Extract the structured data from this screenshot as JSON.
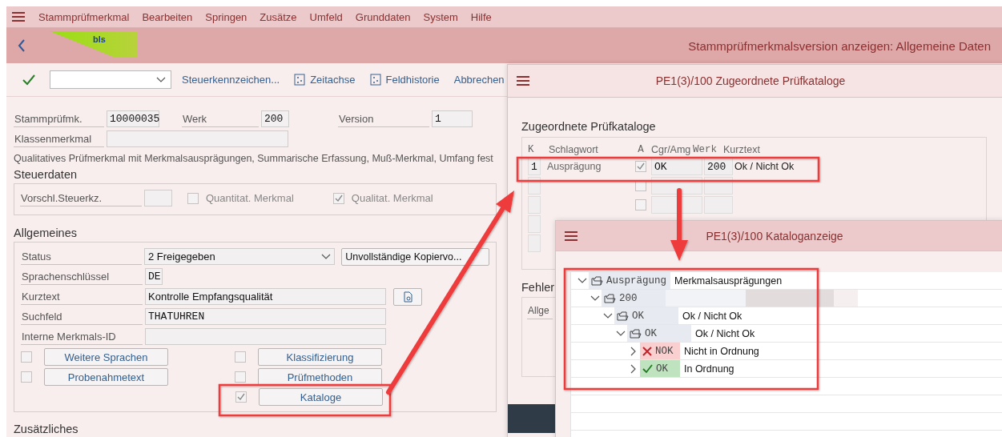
{
  "menu": [
    {
      "label": "Stammprüfmerkmal"
    },
    {
      "label": "Bearbeiten"
    },
    {
      "label": "Springen"
    },
    {
      "label": "Zusätze"
    },
    {
      "label": "Umfeld"
    },
    {
      "label": "Grunddaten"
    },
    {
      "label": "System"
    },
    {
      "label": "Hilfe"
    }
  ],
  "header": {
    "logo": "bls",
    "title": "Stammprüfmerkmalsversion anzeigen: Allgemeine Daten"
  },
  "toolbar": [
    {
      "kind": "text",
      "label": "Steuerkennzeichen..."
    },
    {
      "kind": "icon",
      "label": "Zeitachse"
    },
    {
      "kind": "icon",
      "label": "Feldhistorie"
    },
    {
      "kind": "text",
      "label": "Abbrechen"
    }
  ],
  "head_fields": [
    {
      "label": "Stammprüfmk.",
      "value": "10000035"
    },
    {
      "label": "Werk",
      "value": "200"
    },
    {
      "label": "Version",
      "value": "1"
    }
  ],
  "klassenmerkmal": {
    "label": "Klassenmerkmal"
  },
  "description": "Qualitatives Prüfmerkmal mit Merkmalsausprägungen, Summarische Erfassung, Muß-Merkmal, Umfang fest",
  "steuerdaten": {
    "heading": "Steuerdaten",
    "field_label": "Vorschl.Steuerkz.",
    "checkboxes": [
      {
        "label": "Quantitat. Merkmal",
        "checked": false
      },
      {
        "label": "Qualitat. Merkmal",
        "checked": true
      }
    ]
  },
  "allgemeines": {
    "heading": "Allgemeines",
    "status": {
      "label": "Status",
      "value": "2 Freigegeben",
      "button": "Unvollständige Kopiervo..."
    },
    "fields": [
      {
        "label": "Sprachenschlüssel",
        "value": "DE",
        "kind": "short"
      },
      {
        "label": "Kurztext",
        "value": "Kontrolle Empfangsqualität",
        "kind": "text"
      },
      {
        "label": "Suchfeld",
        "value": "THATUHREN",
        "kind": "mono"
      },
      {
        "label": "Interne Merkmals-ID",
        "kind": "empty"
      }
    ],
    "buttons": [
      [
        {
          "label": "Weitere Sprachen",
          "checked": false
        },
        {
          "label": "Klassifizierung",
          "checked": false
        }
      ],
      [
        {
          "label": "Probenahmetext",
          "checked": false
        },
        {
          "label": "Prüfmethoden",
          "checked": false
        }
      ],
      [
        {
          "label": "Kataloge",
          "checked": true
        }
      ]
    ]
  },
  "next_heading": "Zusätzliches",
  "dialog_catalogs": {
    "title": "PE1(3)/100 Zugeordnete Prüfkataloge",
    "heading": "Zugeordnete Prüfkataloge",
    "columns": [
      "K",
      "Schlagwort",
      "A",
      "Cgr/Amg",
      "Werk",
      "Kurztext"
    ],
    "rows": [
      {
        "kind": "full",
        "k": "1",
        "schlagwort": "Ausprägung",
        "checked": true,
        "cgr": "OK",
        "werk": "200",
        "kurztext": "Ok / Nicht Ok"
      },
      {
        "kind": "full",
        "checked": false
      },
      {
        "kind": "full",
        "checked": false
      },
      {
        "kind": "partial"
      },
      {
        "kind": "partial"
      }
    ],
    "second_heading": "Fehler",
    "second_label": "Allge"
  },
  "dialog_display": {
    "title": "PE1(3)/100 Kataloganzeige",
    "tree": [
      {
        "kind": "folder",
        "expanded": true,
        "key": "Ausprägung",
        "text": "Merkmalsausprägungen",
        "children": [
          {
            "kind": "folder",
            "expanded": true,
            "key": "200",
            "blurred": true,
            "children": [
              {
                "kind": "folder",
                "expanded": true,
                "key": "OK",
                "text": "Ok / Nicht Ok",
                "children": [
                  {
                    "kind": "folder",
                    "expanded": true,
                    "key": "OK",
                    "text": "Ok / Nicht Ok",
                    "children": [
                      {
                        "kind": "reject",
                        "expanded": false,
                        "key": "NOK",
                        "text": "Nicht in Ordnung"
                      },
                      {
                        "kind": "accept",
                        "expanded": false,
                        "key": "OK",
                        "text": "In Ordnung"
                      }
                    ]
                  }
                ]
              }
            ]
          }
        ]
      }
    ]
  }
}
